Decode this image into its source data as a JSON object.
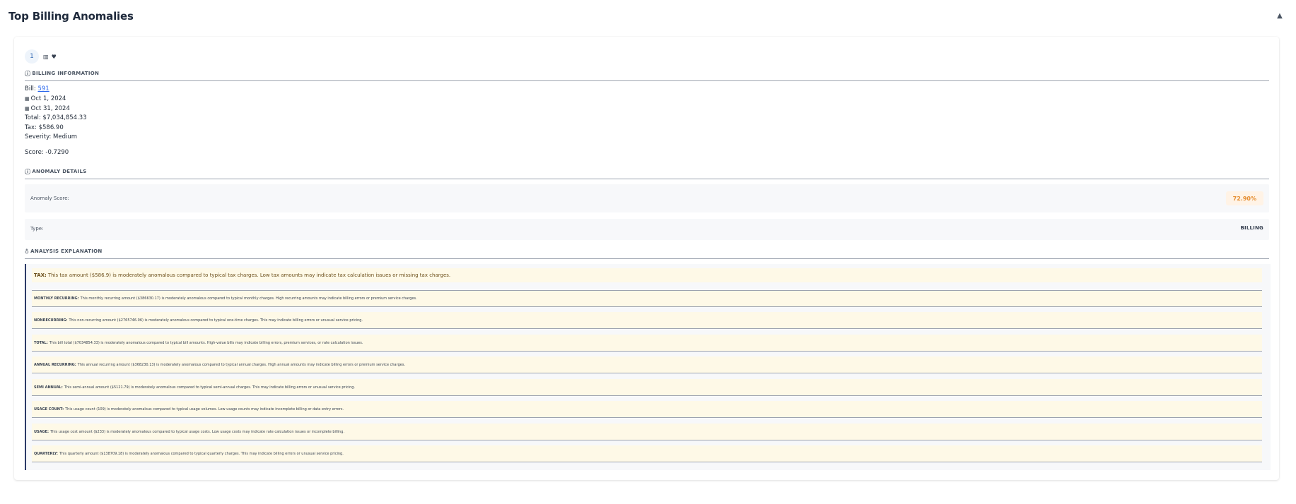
{
  "page": {
    "title": "Top Billing Anomalies",
    "collapse_icon": "chevron-up-icon"
  },
  "anomaly": {
    "rank": "1",
    "billing_section": {
      "title": "BILLING INFORMATION",
      "bill_label": "Bill:",
      "bill_id": "591",
      "period_start": "Oct 1, 2024",
      "period_end": "Oct 31, 2024",
      "total": "Total: $7,034,854.33",
      "tax": "Tax: $586.90",
      "severity": "Severity: Medium",
      "score": "Score: -0.7290"
    },
    "details_section": {
      "title": "ANOMALY DETAILS",
      "score_label": "Anomaly Score:",
      "score_value": "72.90%",
      "type_label": "Type:",
      "type_value": "BILLING"
    },
    "explanation_section": {
      "title": "ANALYSIS EXPLANATION",
      "items": [
        {
          "label": "TAX:",
          "text": "This tax amount ($586.9) is moderately anomalous compared to typical tax charges. Low tax amounts may indicate tax calculation issues or missing tax charges."
        },
        {
          "label": "MONTHLY RECURRING:",
          "text": "This monthly recurring amount ($386630.17) is moderately anomalous compared to typical monthly charges. High recurring amounts may indicate billing errors or premium service charges."
        },
        {
          "label": "NONRECURRING:",
          "text": "This non-recurring amount ($2765746.06) is moderately anomalous compared to typical one-time charges. This may indicate billing errors or unusual service pricing."
        },
        {
          "label": "TOTAL:",
          "text": "This bill total ($7034854.33) is moderately anomalous compared to typical bill amounts. High-value bills may indicate billing errors, premium services, or rate calculation issues."
        },
        {
          "label": "ANNUAL RECURRING:",
          "text": "This annual recurring amount ($368230.13) is moderately anomalous compared to typical annual charges. High annual amounts may indicate billing errors or premium service charges."
        },
        {
          "label": "SEMI ANNUAL:",
          "text": "This semi-annual amount ($5121.79) is moderately anomalous compared to typical semi-annual charges. This may indicate billing errors or unusual service pricing."
        },
        {
          "label": "USAGE COUNT:",
          "text": "This usage count (109) is moderately anomalous compared to typical usage volumes. Low usage counts may indicate incomplete billing or data entry errors."
        },
        {
          "label": "USAGE:",
          "text": "This usage cost amount ($233) is moderately anomalous compared to typical usage costs. Low usage costs may indicate rate calculation issues or incomplete billing."
        },
        {
          "label": "QUARTERLY:",
          "text": "This quarterly amount ($138709.18) is moderately anomalous compared to typical quarterly charges. This may indicate billing errors or unusual service pricing."
        }
      ]
    }
  }
}
